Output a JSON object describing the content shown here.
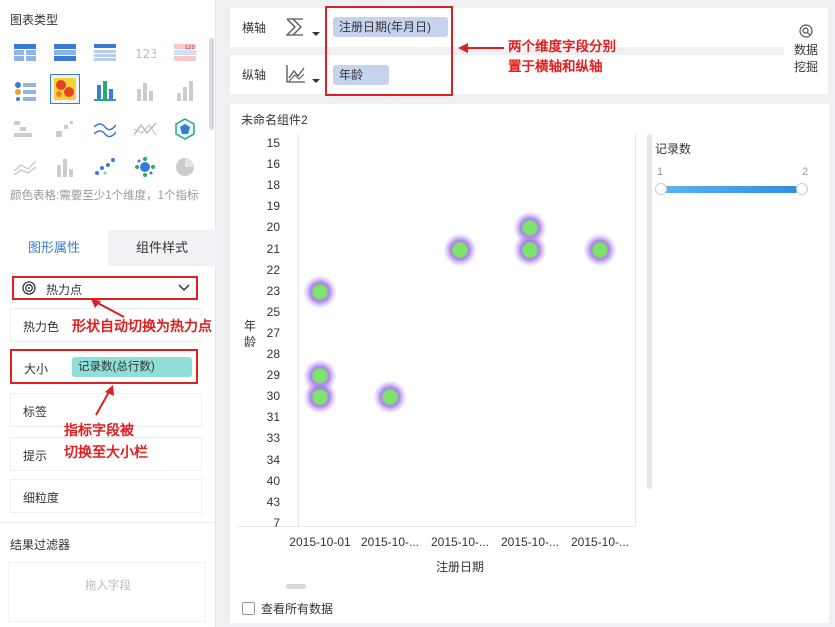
{
  "left_panel": {
    "chart_type_title": "图表类型",
    "chart_types": [
      "table-icon",
      "crosstab-icon",
      "list-table-icon",
      "kpi-number-icon",
      "color-table-icon",
      "grouped-table-icon",
      "heatmap-icon",
      "bar-stack-icon",
      "bar-icon",
      "column-icon",
      "waterfall-icon",
      "scatter-small-icon",
      "line-area-icon",
      "radar-line-icon",
      "chord-icon",
      "area-icon",
      "column-group-icon",
      "scatter-icon",
      "bubble-icon",
      "pie-icon"
    ],
    "hint": "颜色表格:需要至少1个维度，1个指标",
    "tabs": {
      "graph_props": "图形属性",
      "component_style": "组件样式"
    },
    "shape": "热力点",
    "props": {
      "heat_color": "热力色",
      "size": "大小",
      "size_field": "记录数(总行数)",
      "label": "标签",
      "tooltip": "提示",
      "granularity": "细粒度"
    },
    "filter_title": "结果过滤器",
    "filter_drop_hint": "拖入字段"
  },
  "annotations": {
    "shape_note": "形状自动切换为热力点",
    "size_note_line1": "指标字段被",
    "size_note_line2": "切换至大小栏",
    "axis_note_line1": "两个维度字段分别",
    "axis_note_line2": "置于横轴和纵轴"
  },
  "axis_panel": {
    "x_label": "横轴",
    "x_field": "注册日期(年月日)",
    "y_label": "纵轴",
    "y_field": "年龄"
  },
  "mining_button": {
    "line1": "数据",
    "line2": "挖掘"
  },
  "widget": {
    "title": "未命名组件2",
    "show_all_data": "查看所有数据",
    "legend_title": "记录数",
    "legend_min": "1",
    "legend_max": "2"
  },
  "chart_data": {
    "type": "heatmap",
    "xlabel": "注册日期",
    "ylabel": "年龄",
    "x_categories": [
      "2015-10-01",
      "2015-10-...",
      "2015-10-...",
      "2015-10-...",
      "2015-10-..."
    ],
    "y_categories": [
      "15",
      "16",
      "18",
      "19",
      "20",
      "21",
      "22",
      "23",
      "25",
      "27",
      "28",
      "29",
      "30",
      "31",
      "33",
      "34",
      "40",
      "43",
      "7"
    ],
    "points": [
      {
        "x": "2015-10-01",
        "x_index": 0,
        "y": "23",
        "count": 1
      },
      {
        "x": "2015-10-01",
        "x_index": 0,
        "y": "29",
        "count": 1
      },
      {
        "x": "2015-10-01",
        "x_index": 0,
        "y": "30",
        "count": 1
      },
      {
        "x": "2015-10-...",
        "x_index": 1,
        "y": "30",
        "count": 1
      },
      {
        "x": "2015-10-...",
        "x_index": 2,
        "y": "21",
        "count": 1
      },
      {
        "x": "2015-10-...",
        "x_index": 3,
        "y": "20",
        "count": 1
      },
      {
        "x": "2015-10-...",
        "x_index": 3,
        "y": "21",
        "count": 1
      },
      {
        "x": "2015-10-...",
        "x_index": 4,
        "y": "21",
        "count": 1
      }
    ],
    "legend_range": [
      1,
      2
    ]
  }
}
